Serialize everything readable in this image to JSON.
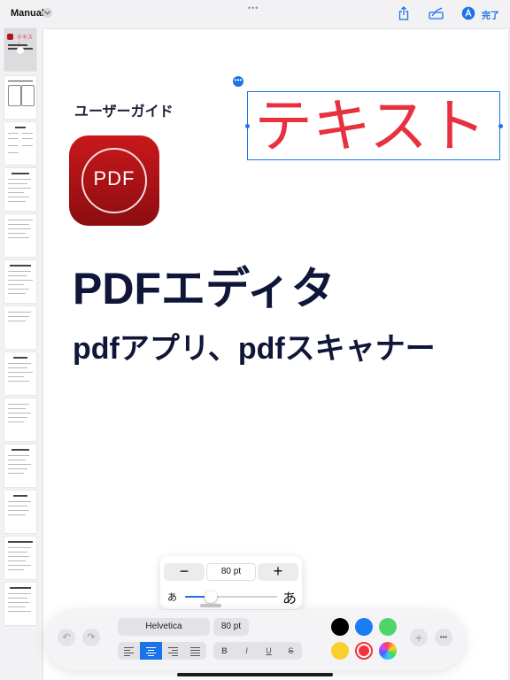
{
  "header": {
    "doc_title": "Manual",
    "done_label": "完了",
    "icons": [
      "chevron-down-icon",
      "more-dots-icon",
      "share-icon",
      "markup-pen-icon",
      "text-format-icon"
    ],
    "grab_dots": "•••"
  },
  "page": {
    "user_guide": "ユーザーガイド",
    "app_icon_text": "PDF",
    "heading1": "PDFエディタ",
    "heading2": "pdfアプリ、pdfスキャナー",
    "selected_text": "テキスト",
    "selected_text_color": "#e8303f",
    "selection_color": "#1a73e8"
  },
  "size_popover": {
    "minus": "−",
    "plus": "+",
    "value": "80 pt",
    "small_glyph": "あ",
    "large_glyph": "あ",
    "slider_level": 0.28
  },
  "toolbar": {
    "font_name": "Helvetica",
    "font_size": "80 pt",
    "alignment_options": [
      "left",
      "center",
      "right",
      "justify"
    ],
    "active_alignment": "center",
    "style_buttons": [
      "B",
      "I",
      "U",
      "S"
    ],
    "undo_icon": "undo-icon",
    "redo_icon": "redo-icon",
    "add_label": "+",
    "more_label": "•••",
    "colors": [
      "#000000",
      "#1a7cf2",
      "#4fd46a",
      "#f9cf2b",
      "#f2343c",
      "color-wheel"
    ],
    "selected_color": "#f2343c"
  }
}
